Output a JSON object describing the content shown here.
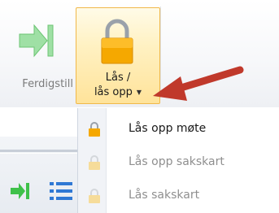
{
  "ribbon": {
    "ferdigstill": {
      "label": "Ferdigstill",
      "icon": "arrow-to-bar-icon",
      "color": "#3fc14a"
    },
    "lock_button": {
      "line1": "Lås /",
      "line2": "lås opp",
      "icon": "padlock-icon",
      "dropdown_icon": "triangle-down-icon",
      "color": "#f5a800"
    },
    "annotation": {
      "icon": "red-arrow-pointer",
      "color": "#c0392b"
    }
  },
  "lower_toolbar": {
    "icons": [
      "arrow-to-bar-icon",
      "list-icon"
    ]
  },
  "dropdown_menu": {
    "items": [
      {
        "label": "Lås opp møte",
        "icon": "padlock-icon",
        "enabled": true
      },
      {
        "label": "Lås opp sakskart",
        "icon": "padlock-icon",
        "enabled": false
      },
      {
        "label": "Lås sakskart",
        "icon": "padlock-icon",
        "enabled": false
      }
    ]
  }
}
